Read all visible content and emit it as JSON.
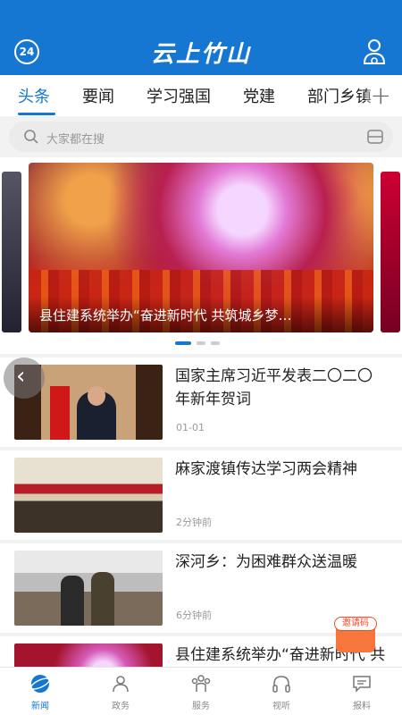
{
  "header": {
    "badge": "24",
    "title": "云上竹山"
  },
  "tabs": [
    {
      "label": "头条",
      "active": true
    },
    {
      "label": "要闻",
      "active": false
    },
    {
      "label": "学习强国",
      "active": false
    },
    {
      "label": "党建",
      "active": false
    },
    {
      "label": "部门乡镇",
      "active": false
    }
  ],
  "search": {
    "placeholder": "大家都在搜"
  },
  "carousel": {
    "caption": "县住建系统举办“奋进新时代 共筑城乡梦…",
    "dot_count": 3,
    "active_dot": 0
  },
  "news": [
    {
      "title": "国家主席习近平发表二〇二〇年新年贺词",
      "time": "01-01"
    },
    {
      "title": "麻家渡镇传达学习两会精神",
      "time": "2分钟前"
    },
    {
      "title": "深河乡：为困难群众送温暖",
      "time": "6分钟前"
    },
    {
      "title": "县住建系统举办“奋进新时代 共筑城乡梦”文艺",
      "time": ""
    }
  ],
  "invite": {
    "label": "邀请码"
  },
  "bottom_nav": [
    {
      "label": "新闻",
      "icon": "planet-icon",
      "active": true
    },
    {
      "label": "政务",
      "icon": "people-icon",
      "active": false
    },
    {
      "label": "服务",
      "icon": "service-icon",
      "active": false
    },
    {
      "label": "视听",
      "icon": "headphones-icon",
      "active": false
    },
    {
      "label": "报料",
      "icon": "chat-icon",
      "active": false
    }
  ],
  "colors": {
    "brand": "#1677d2",
    "accent": "#f7763c"
  }
}
